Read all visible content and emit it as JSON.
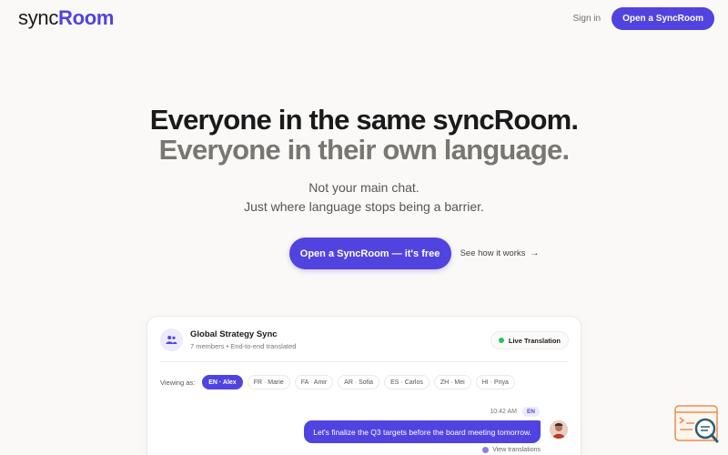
{
  "header": {
    "logo_part1": "sync",
    "logo_part2": "Room",
    "signin_label": "Sign in",
    "open_label": "Open a SyncRoom"
  },
  "hero": {
    "title_line1": "Everyone in the same syncRoom.",
    "title_line2": "Everyone in their own language.",
    "sub_line1": "Not your main chat.",
    "sub_line2": "Just where language stops being a barrier.",
    "cta_label": "Open a SyncRoom — it's free",
    "see_how_label": "See how it works"
  },
  "chat": {
    "room_name": "Global Strategy Sync",
    "room_meta": "7 members • End-to-end translated",
    "live_label": "Live Translation",
    "viewing_label": "Viewing as:",
    "languages": [
      {
        "label": "EN · Alex",
        "active": true
      },
      {
        "label": "FR · Marie",
        "active": false
      },
      {
        "label": "FA · Amir",
        "active": false
      },
      {
        "label": "AR · Sofia",
        "active": false
      },
      {
        "label": "ES · Carlos",
        "active": false
      },
      {
        "label": "ZH · Mei",
        "active": false
      },
      {
        "label": "HI · Priya",
        "active": false
      }
    ],
    "message": {
      "time": "10:42 AM",
      "lang": "EN",
      "text": "Let's finalize the Q3 targets before the board meeting tomorrow.",
      "view_translations": "View translations"
    }
  },
  "colors": {
    "accent": "#5143e0",
    "live": "#22c55e"
  },
  "icons": {
    "room": "people-icon",
    "arrow": "arrow-right-icon",
    "widget": "search-chat-icon"
  }
}
